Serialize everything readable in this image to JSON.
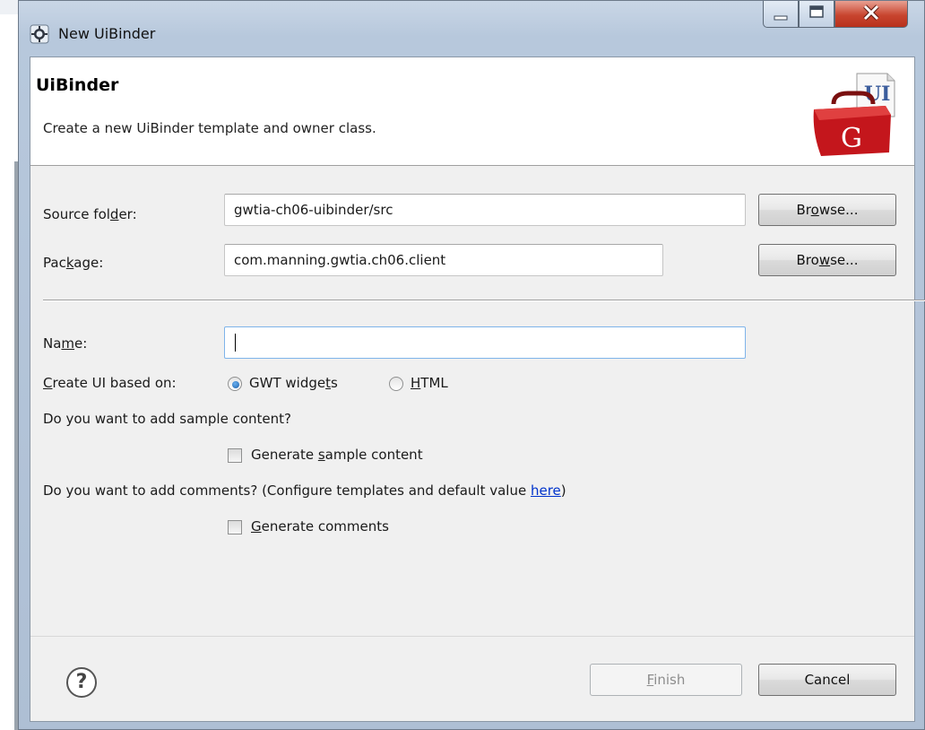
{
  "window": {
    "title": "New UiBinder",
    "minimize_glyph": "—",
    "maximize_glyph": "▢",
    "close_glyph": "✕"
  },
  "header": {
    "title": "UiBinder",
    "description": "Create a new UiBinder template and owner class.",
    "banner_icon": "gwt-toolbox-ui-icon",
    "banner_letter": "G",
    "banner_tag": "UI"
  },
  "form": {
    "source_folder": {
      "label_pre": "Source fol",
      "label_mnemonic": "d",
      "label_post": "er:",
      "value": "gwtia-ch06-uibinder/src",
      "browse_pre": "Br",
      "browse_mnemonic": "o",
      "browse_post": "wse..."
    },
    "package": {
      "label_pre": "Pac",
      "label_mnemonic": "k",
      "label_post": "age:",
      "value": "com.manning.gwtia.ch06.client",
      "browse_pre": "Bro",
      "browse_mnemonic": "w",
      "browse_post": "se..."
    },
    "name": {
      "label_pre": "Na",
      "label_mnemonic": "m",
      "label_post": "e:",
      "value": ""
    },
    "create_ui": {
      "label_mnemonic": "C",
      "label_post": "reate UI based on:",
      "option1_pre": "GWT widge",
      "option1_mnemonic": "t",
      "option1_post": "s",
      "option2_mnemonic": "H",
      "option2_post": "TML",
      "selected": "GWT widgets"
    },
    "sample_question": "Do you want to add sample content?",
    "sample_checkbox": {
      "label_pre": "Generate ",
      "label_mnemonic": "s",
      "label_post": "ample content",
      "checked": false
    },
    "comments_question_pre": "Do you want to add comments? (Configure templates and default value ",
    "comments_link": "here",
    "comments_question_post": ")",
    "comments_checkbox": {
      "label_mnemonic": "G",
      "label_post": "enerate comments",
      "checked": false
    }
  },
  "footer": {
    "help_glyph": "?",
    "finish_mnemonic": "F",
    "finish_post": "inish",
    "cancel": "Cancel"
  },
  "colors": {
    "accent": "#1b5ea8",
    "close_red": "#c8452f",
    "link": "#0033cc"
  }
}
